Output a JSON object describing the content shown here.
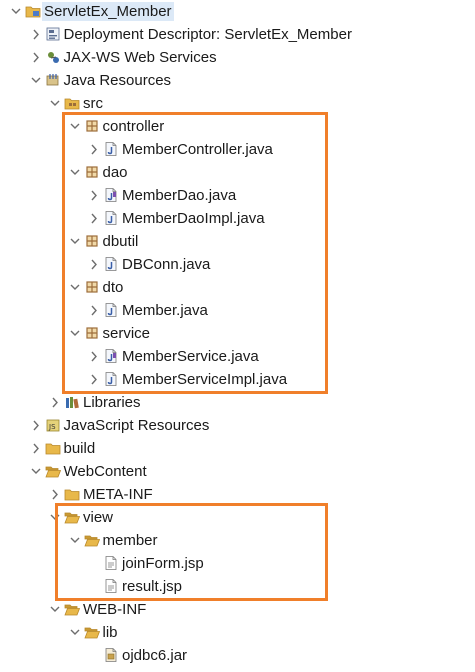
{
  "tree": {
    "rows": [
      {
        "label": "ServletEx_Member",
        "depth": 0,
        "twisty": "expanded",
        "icon": "project-icon",
        "selected": true
      },
      {
        "label": "Deployment Descriptor: ServletEx_Member",
        "depth": 1,
        "twisty": "collapsed",
        "icon": "deployment-descriptor-icon"
      },
      {
        "label": "JAX-WS Web Services",
        "depth": 1,
        "twisty": "collapsed",
        "icon": "web-services-icon"
      },
      {
        "label": "Java Resources",
        "depth": 1,
        "twisty": "expanded",
        "icon": "java-resources-icon"
      },
      {
        "label": "src",
        "depth": 2,
        "twisty": "expanded",
        "icon": "source-folder-icon"
      },
      {
        "label": "controller",
        "depth": 3,
        "twisty": "expanded",
        "icon": "package-icon"
      },
      {
        "label": "MemberController.java",
        "depth": 4,
        "twisty": "collapsed",
        "icon": "java-file-icon"
      },
      {
        "label": "dao",
        "depth": 3,
        "twisty": "expanded",
        "icon": "package-icon"
      },
      {
        "label": "MemberDao.java",
        "depth": 4,
        "twisty": "collapsed",
        "icon": "java-interface-file-icon"
      },
      {
        "label": "MemberDaoImpl.java",
        "depth": 4,
        "twisty": "collapsed",
        "icon": "java-file-icon"
      },
      {
        "label": "dbutil",
        "depth": 3,
        "twisty": "expanded",
        "icon": "package-icon"
      },
      {
        "label": "DBConn.java",
        "depth": 4,
        "twisty": "collapsed",
        "icon": "java-file-icon"
      },
      {
        "label": "dto",
        "depth": 3,
        "twisty": "expanded",
        "icon": "package-icon"
      },
      {
        "label": "Member.java",
        "depth": 4,
        "twisty": "collapsed",
        "icon": "java-file-icon"
      },
      {
        "label": "service",
        "depth": 3,
        "twisty": "expanded",
        "icon": "package-icon"
      },
      {
        "label": "MemberService.java",
        "depth": 4,
        "twisty": "collapsed",
        "icon": "java-interface-file-icon"
      },
      {
        "label": "MemberServiceImpl.java",
        "depth": 4,
        "twisty": "collapsed",
        "icon": "java-file-icon"
      },
      {
        "label": "Libraries",
        "depth": 2,
        "twisty": "collapsed",
        "icon": "libraries-icon"
      },
      {
        "label": "JavaScript Resources",
        "depth": 1,
        "twisty": "collapsed",
        "icon": "javascript-resources-icon"
      },
      {
        "label": "build",
        "depth": 1,
        "twisty": "collapsed",
        "icon": "folder-icon"
      },
      {
        "label": "WebContent",
        "depth": 1,
        "twisty": "expanded",
        "icon": "folder-open-icon"
      },
      {
        "label": "META-INF",
        "depth": 2,
        "twisty": "collapsed",
        "icon": "folder-icon"
      },
      {
        "label": "view",
        "depth": 2,
        "twisty": "expanded",
        "icon": "folder-open-icon"
      },
      {
        "label": "member",
        "depth": 3,
        "twisty": "expanded",
        "icon": "folder-open-icon"
      },
      {
        "label": "joinForm.jsp",
        "depth": 4,
        "twisty": "none",
        "icon": "jsp-file-icon"
      },
      {
        "label": "result.jsp",
        "depth": 4,
        "twisty": "none",
        "icon": "jsp-file-icon"
      },
      {
        "label": "WEB-INF",
        "depth": 2,
        "twisty": "expanded",
        "icon": "folder-open-icon"
      },
      {
        "label": "lib",
        "depth": 3,
        "twisty": "expanded",
        "icon": "folder-open-icon"
      },
      {
        "label": "ojdbc6.jar",
        "depth": 4,
        "twisty": "none",
        "icon": "jar-file-icon"
      }
    ]
  },
  "highlights": [
    {
      "name": "src-packages-highlight",
      "first_row": 5,
      "last_row": 16
    },
    {
      "name": "view-folder-highlight",
      "first_row": 22,
      "last_row": 25
    }
  ],
  "colors": {
    "highlight_frame": "#f07f2a",
    "selection": "#dce9f7",
    "folder": "#e8b84a",
    "package": "#9c6d3b",
    "java_blue": "#3a5fa8"
  }
}
